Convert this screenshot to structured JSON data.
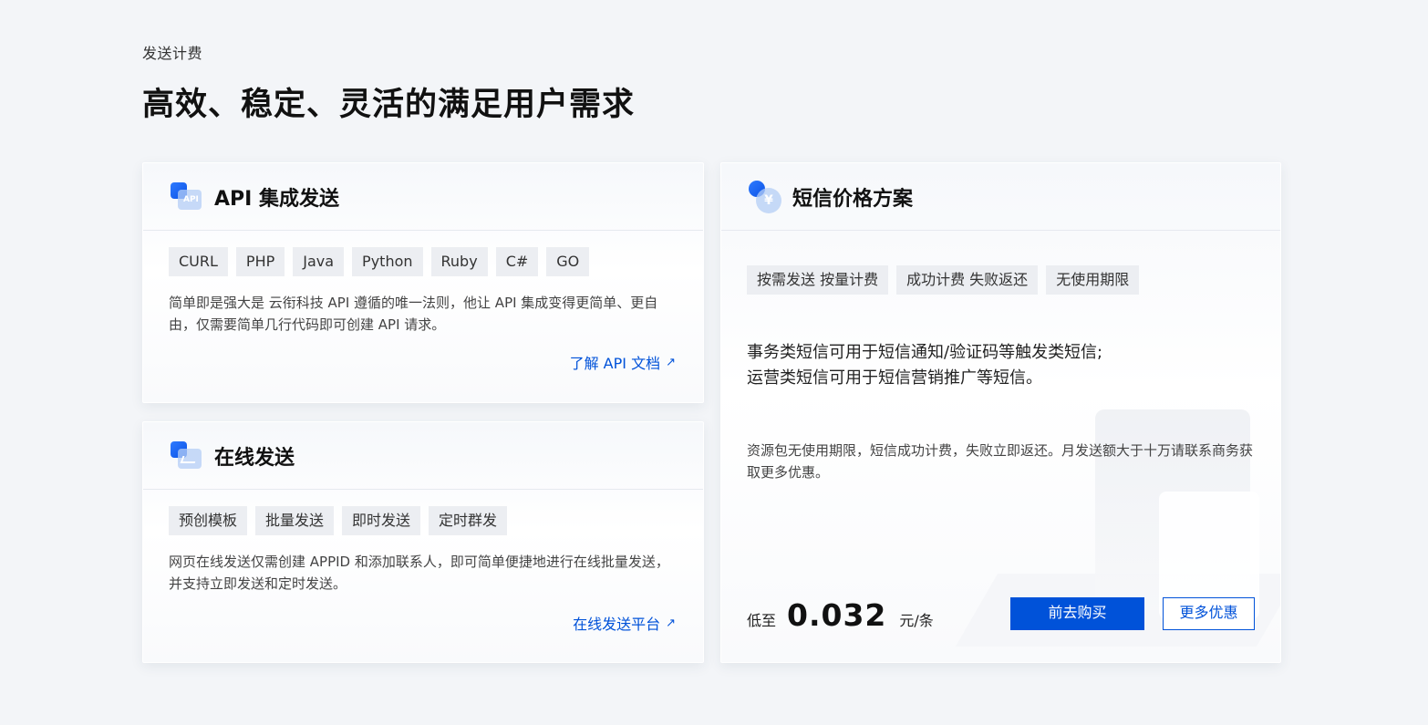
{
  "header": {
    "kicker": "发送计费",
    "title": "高效、稳定、灵活的满足用户需求"
  },
  "api_card": {
    "icon": "api-icon",
    "icon_text": "API",
    "title": "API 集成发送",
    "tags": [
      "CURL",
      "PHP",
      "Java",
      "Python",
      "Ruby",
      "C#",
      "GO"
    ],
    "desc": "简单即是强大是 云衔科技 API 遵循的唯一法则，他让 API 集成变得更简单、更自由，仅需要简单几行代码即可创建 API 请求。",
    "link": "了解 API 文档",
    "link_icon": "↗"
  },
  "online_card": {
    "icon": "online-send-icon",
    "title": "在线发送",
    "tags": [
      "预创模板",
      "批量发送",
      "即时发送",
      "定时群发"
    ],
    "desc": "网页在线发送仅需创建 APPID 和添加联系人，即可简单便捷地进行在线批量发送，并支持立即发送和定时发送。",
    "link": "在线发送平台",
    "link_icon": "↗"
  },
  "price_card": {
    "icon": "price-icon",
    "icon_text": "¥",
    "title": "短信价格方案",
    "tags": [
      "按需发送 按量计费",
      "成功计费 失败返还",
      "无使用期限"
    ],
    "main_line1": "事务类短信可用于短信通知/验证码等触发类短信;",
    "main_line2": "运营类短信可用于短信营销推广等短信。",
    "note": "资源包无使用期限，短信成功计费，失败立即返还。月发送额大于十万请联系商务获取更多优惠。",
    "price_prefix": "低至",
    "price_value": "0.032",
    "price_unit": "元/条",
    "buy_label": "前去购买",
    "more_label": "更多优惠"
  },
  "colors": {
    "accent": "#0052d9",
    "background": "#f3f5f8",
    "tag_bg": "#eceef2"
  }
}
